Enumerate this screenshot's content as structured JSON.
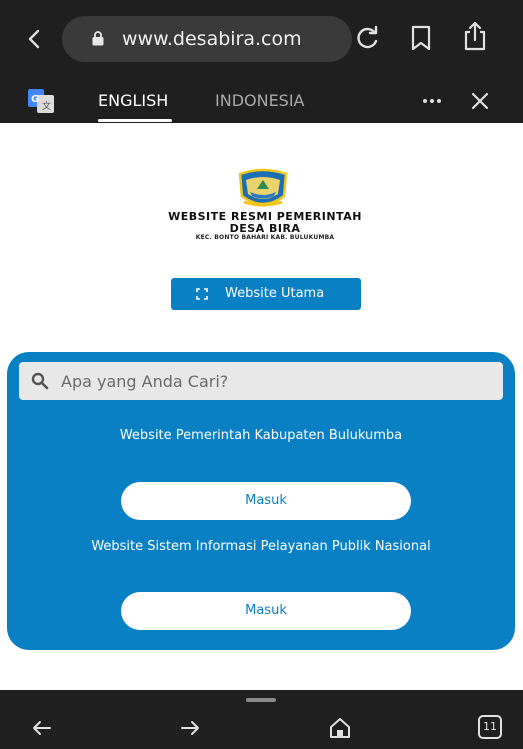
{
  "browser": {
    "url": "www.desabira.com",
    "translate": {
      "tab_english": "ENGLISH",
      "tab_indonesia": "INDONESIA"
    },
    "tabs_count": "11"
  },
  "site": {
    "title_line1": "WEBSITE RESMI PEMERINTAH",
    "title_line2": "DESA BIRA",
    "subtitle": "KEC. BONTO BAHARI KAB. BULUKUMBA",
    "main_button": "Website Utama"
  },
  "panel": {
    "search_placeholder": "Apa yang Anda Cari?",
    "section1_heading": "Website Pemerintah Kabupaten Bulukumba",
    "section1_button": "Masuk",
    "section2_heading": "Website Sistem Informasi Pelayanan Publik Nasional",
    "section2_button": "Masuk"
  },
  "colors": {
    "accent": "#0a80c4",
    "browser_chrome": "#1f1f1f"
  }
}
